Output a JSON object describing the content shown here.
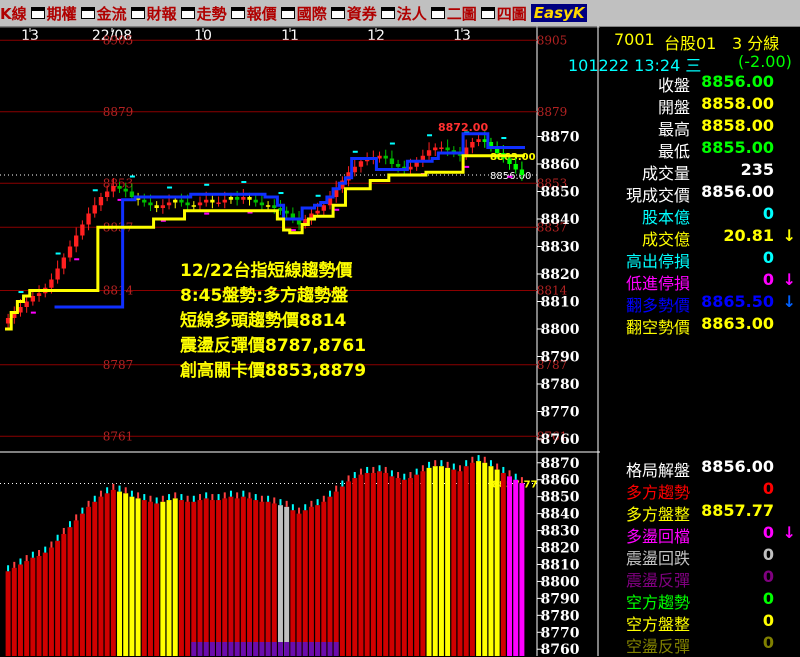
{
  "menu": [
    {
      "label": "K線",
      "icon": "k-icon"
    },
    {
      "label": "期權",
      "icon": "window-icon"
    },
    {
      "label": "金流",
      "icon": "window-icon"
    },
    {
      "label": "財報",
      "icon": "window-icon"
    },
    {
      "label": "走勢",
      "icon": "window-icon"
    },
    {
      "label": "報價",
      "icon": "window-icon"
    },
    {
      "label": "國際",
      "icon": "window-icon"
    },
    {
      "label": "資券",
      "icon": "window-icon"
    },
    {
      "label": "法人",
      "icon": "window-icon"
    },
    {
      "label": "二圖",
      "icon": "window-icon"
    },
    {
      "label": "四圖",
      "icon": "window-icon"
    },
    {
      "label": "EasyK",
      "icon": "easyk-icon"
    }
  ],
  "header": {
    "symbol": "7001",
    "name": "台股01",
    "period": "3 分線",
    "date": "101222 13:24 三",
    "change": "(-2.00)"
  },
  "quotes": [
    {
      "label": "收盤",
      "value": "8856.00",
      "color": "#00ff00"
    },
    {
      "label": "開盤",
      "value": "8858.00",
      "color": "#ffff00"
    },
    {
      "label": "最高",
      "value": "8858.00",
      "color": "#ffff00"
    },
    {
      "label": "最低",
      "value": "8855.00",
      "color": "#00ff00"
    },
    {
      "label": "成交量",
      "value": "235",
      "color": "#ffffff"
    },
    {
      "label": "現成交價",
      "value": "8856.00",
      "color": "#ffffff"
    },
    {
      "label": "股本億",
      "value": "0",
      "color": "#00ffff"
    },
    {
      "label": "成交億",
      "value": "20.81",
      "color": "#ffff00",
      "arrow": "↓"
    },
    {
      "label": "高出停損",
      "value": "0",
      "color": "#00ffff"
    },
    {
      "label": "低進停損",
      "value": "0",
      "color": "#ff00ff",
      "arrow": "↓"
    },
    {
      "label": "翻多勢價",
      "value": "8865.50",
      "color": "#0000ff",
      "arrow": "↓"
    },
    {
      "label": "翻空勢價",
      "value": "8863.00",
      "color": "#ffff00"
    }
  ],
  "indicators": [
    {
      "label": "格局解盤",
      "value": "8856.00",
      "color": "#ffffff"
    },
    {
      "label": "多方趨勢",
      "value": "0",
      "color": "#ff0000"
    },
    {
      "label": "多方盤整",
      "value": "8857.77",
      "color": "#ffff00"
    },
    {
      "label": "多盪回檔",
      "value": "0",
      "color": "#ff00ff",
      "arrow": "↓"
    },
    {
      "label": "震盪回跌",
      "value": "0",
      "color": "#c0c0c0"
    },
    {
      "label": "震盪反彈",
      "value": "0",
      "color": "#800080"
    },
    {
      "label": "空方趨勢",
      "value": "0",
      "color": "#00ff00"
    },
    {
      "label": "空方盤整",
      "value": "0",
      "color": "#ffff00"
    },
    {
      "label": "空盪反彈",
      "value": "0",
      "color": "#808000"
    }
  ],
  "annotation": [
    "12/22台指短線趨勢價",
    "8:45盤勢:多方趨勢盤",
    "短線多頭趨勢價8814",
    "震盪反彈價8787,8761",
    "創高關卡價8853,8879"
  ],
  "chart_data": {
    "type": "candlestick",
    "x_ticks": [
      "13",
      "22/08",
      "10",
      "11",
      "12",
      "13"
    ],
    "main": {
      "ylim": [
        8756,
        8908
      ],
      "y_ticks": [
        8870,
        8860,
        8850,
        8840,
        8830,
        8820,
        8810,
        8800,
        8790,
        8780,
        8770,
        8760
      ],
      "level_lines": [
        {
          "value": 8905,
          "label": "8905"
        },
        {
          "value": 8879,
          "label": "8879"
        },
        {
          "value": 8853,
          "label": "8853"
        },
        {
          "value": 8837,
          "label": "8837"
        },
        {
          "value": 8814,
          "label": "8814"
        },
        {
          "value": 8787,
          "label": "8787"
        },
        {
          "value": 8761,
          "label": "8761"
        }
      ],
      "reference_price": {
        "value": 8856.0,
        "label": "8856.00"
      },
      "high_marker": {
        "value": 8872.0,
        "label": "8872.00"
      },
      "yellow_label": {
        "value": 8863.0,
        "label": "8863.00"
      },
      "price_series": [
        8804,
        8806,
        8808,
        8810,
        8812,
        8813,
        8815,
        8818,
        8822,
        8826,
        8830,
        8834,
        8838,
        8842,
        8845,
        8848,
        8850,
        8852,
        8851,
        8850,
        8848,
        8847,
        8846,
        8845,
        8844,
        8845,
        8846,
        8847,
        8846,
        8845,
        8845,
        8846,
        8847,
        8846,
        8846,
        8847,
        8848,
        8847,
        8848,
        8847,
        8846,
        8845,
        8845,
        8844,
        8843,
        8842,
        8840,
        8838,
        8840,
        8842,
        8843,
        8845,
        8848,
        8851,
        8854,
        8857,
        8859,
        8861,
        8862,
        8862,
        8863,
        8862,
        8860,
        8859,
        8858,
        8859,
        8861,
        8863,
        8865,
        8866,
        8866,
        8865,
        8864,
        8863,
        8866,
        8868,
        8869,
        8868,
        8866,
        8864,
        8862,
        8860,
        8858,
        8856
      ],
      "yellow_line": [
        8800,
        8806,
        8810,
        8812,
        8814,
        8814,
        8814,
        8814,
        8814,
        8814,
        8814,
        8814,
        8814,
        8814,
        8814,
        8837,
        8837,
        8837,
        8837,
        8837,
        8837,
        8837,
        8837,
        8837,
        8840,
        8840,
        8840,
        8840,
        8840,
        8843,
        8843,
        8843,
        8843,
        8843,
        8843,
        8843,
        8843,
        8843,
        8843,
        8843,
        8843,
        8843,
        8843,
        8843,
        8840,
        8836,
        8835,
        8835,
        8838,
        8840,
        8841,
        8841,
        8841,
        8845,
        8845,
        8851,
        8851,
        8851,
        8851,
        8854,
        8854,
        8854,
        8856,
        8856,
        8856,
        8856,
        8856,
        8856,
        8857,
        8857,
        8857,
        8857,
        8857,
        8857,
        8863,
        8863,
        8863,
        8863,
        8863,
        8863,
        8863,
        8863,
        8863,
        8863
      ],
      "blue_line": [
        null,
        null,
        null,
        null,
        null,
        null,
        null,
        null,
        8808,
        8808,
        8808,
        8808,
        8808,
        8808,
        8808,
        8808,
        8808,
        8808,
        8808,
        8847,
        8847,
        8848,
        8848,
        8848,
        8848,
        8848,
        8848,
        8848,
        8848,
        8848,
        8849,
        8849,
        8849,
        8849,
        8849,
        8849,
        8849,
        8849,
        8849,
        8849,
        8849,
        8849,
        8848,
        8848,
        8845,
        8840,
        8840,
        8840,
        8844,
        8844,
        8845,
        8846,
        8848,
        8851,
        8853,
        8855,
        8862,
        8862,
        8862,
        8862,
        8858,
        8858,
        8858,
        8858,
        8858,
        8861,
        8861,
        8861,
        8861,
        8862,
        8864,
        8864,
        8864,
        8864,
        8871,
        8871,
        8871,
        8871,
        8866,
        8866,
        8866,
        8866,
        8866,
        8866
      ]
    },
    "sub": {
      "ylim": [
        8756,
        8874
      ],
      "y_ticks": [
        8870,
        8860,
        8850,
        8840,
        8830,
        8820,
        8810,
        8800,
        8790,
        8780,
        8770,
        8760
      ],
      "reference_value": {
        "value": 8857.77,
        "label": "8857.77"
      }
    }
  }
}
